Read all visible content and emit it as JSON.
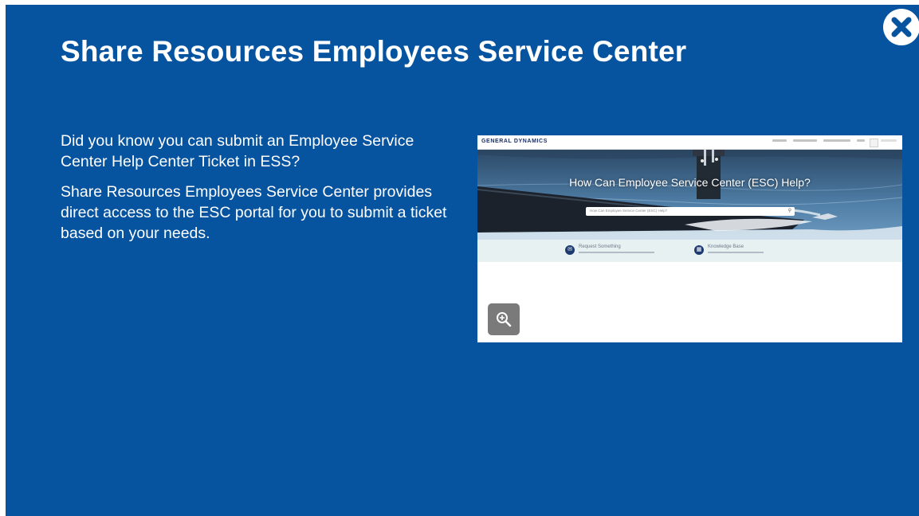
{
  "slide": {
    "title": "Share Resources Employees Service Center",
    "paragraphs": [
      "Did you know you can submit an Employee Service Center Help Center Ticket in ESS?",
      "Share Resources Employees Service Center provides direct access to the ESC portal for you to submit a ticket based on your needs."
    ],
    "close_icon": "close-icon",
    "zoom_icon": "zoom-in-icon"
  },
  "preview": {
    "logo": "GENERAL DYNAMICS",
    "hero_title": "How Can Employee Service Center (ESC) Help?",
    "search_placeholder": "How Can Employee Service Center (ESC) Help?",
    "search_icon": "search-icon",
    "links": [
      {
        "label": "Request Something",
        "icon": "request-icon"
      },
      {
        "label": "Knowledge Base",
        "icon": "knowledge-icon"
      }
    ]
  },
  "colors": {
    "background": "#06539f",
    "text": "#ffffff",
    "close_button": "#ffffff",
    "close_glyph": "#06539f",
    "zoom_button": "#7a7a7a"
  }
}
